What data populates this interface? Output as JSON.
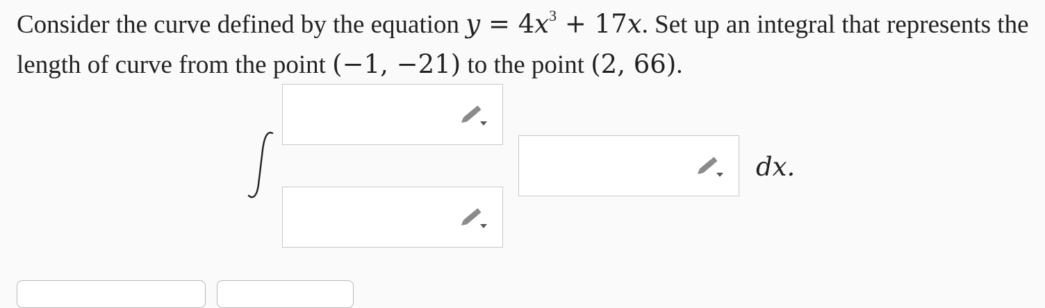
{
  "question": {
    "part1": "Consider the curve defined by the equation ",
    "eq_y": "y",
    "eq_equals": " = ",
    "eq_coef": "4",
    "eq_x": "x",
    "eq_exp": "3",
    "eq_plus": " + 17",
    "eq_x2": "x",
    "part2": ". Set up an integral that represents the length of curve from the point ",
    "point1": "(−1, −21)",
    "part3": " to the point ",
    "point2": "(2, 66)",
    "part4": "."
  },
  "integral": {
    "upper_limit_value": "",
    "lower_limit_value": "",
    "integrand_value": "",
    "differential": "dx."
  },
  "icons": {
    "edit_icon": "pencil-dropdown-icon",
    "icon_color": "#8a8a8a"
  },
  "buttons": {
    "left_label": "",
    "right_label": ""
  }
}
